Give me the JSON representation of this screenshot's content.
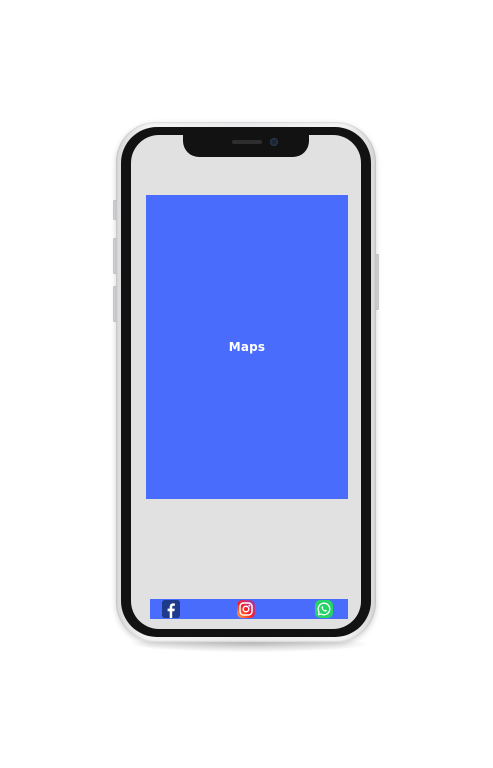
{
  "screen": {
    "main_panel": {
      "label": "Maps",
      "color": "#4a6cfd"
    },
    "social_bar": {
      "color": "#4a6cfd",
      "items": [
        {
          "icon": "facebook-icon"
        },
        {
          "icon": "instagram-icon"
        },
        {
          "icon": "whatsapp-icon"
        }
      ]
    },
    "background_color": "#e1e1e1"
  }
}
